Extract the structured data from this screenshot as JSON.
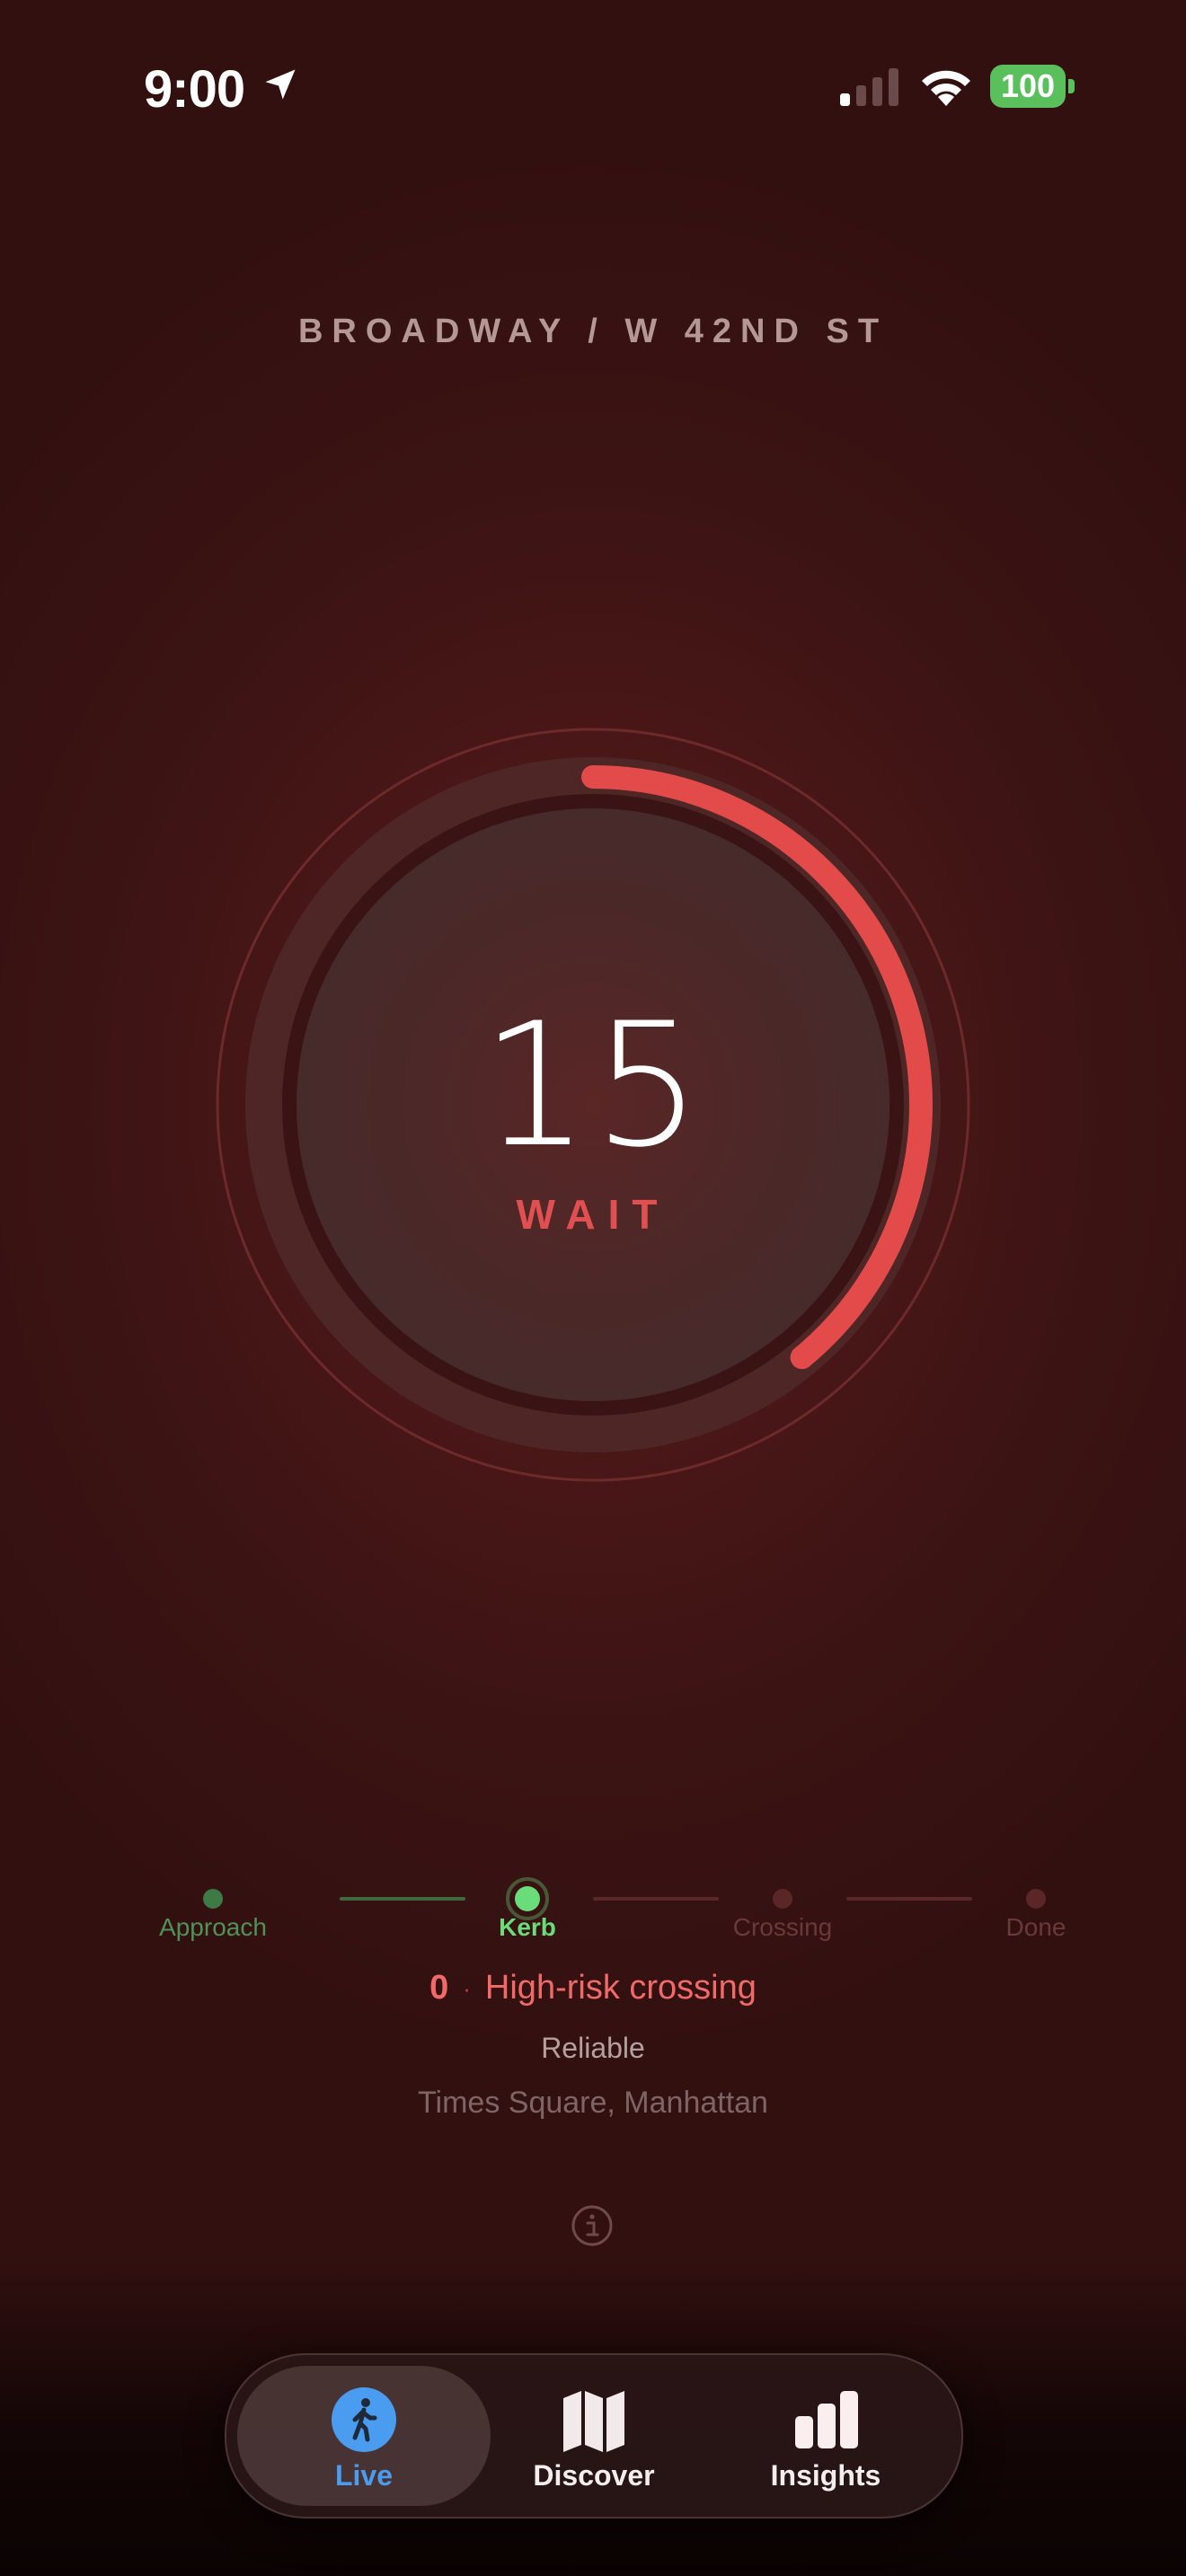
{
  "status_bar": {
    "time": "9:00",
    "battery": "100"
  },
  "header": {
    "street": "BROADWAY / W 42ND ST"
  },
  "signal": {
    "countdown": "15",
    "state": "WAIT",
    "progress": 0.39
  },
  "stepper": {
    "steps": [
      {
        "label": "Approach",
        "status": "done"
      },
      {
        "label": "Kerb",
        "status": "current"
      },
      {
        "label": "Crossing",
        "status": "pending"
      },
      {
        "label": "Done",
        "status": "pending"
      }
    ]
  },
  "details": {
    "risk_count": "0",
    "separator": "·",
    "risk_label": "High-risk crossing",
    "reliability": "Reliable",
    "location": "Times Square, Manhattan"
  },
  "tabs": [
    {
      "label": "Live",
      "icon": "pedestrian-icon",
      "active": true
    },
    {
      "label": "Discover",
      "icon": "map-icon",
      "active": false
    },
    {
      "label": "Insights",
      "icon": "bar-chart-icon",
      "active": false
    }
  ],
  "colors": {
    "accent_red": "#e24b4a",
    "active_green": "#6bdc7a",
    "live_blue": "#4a9cf0"
  }
}
